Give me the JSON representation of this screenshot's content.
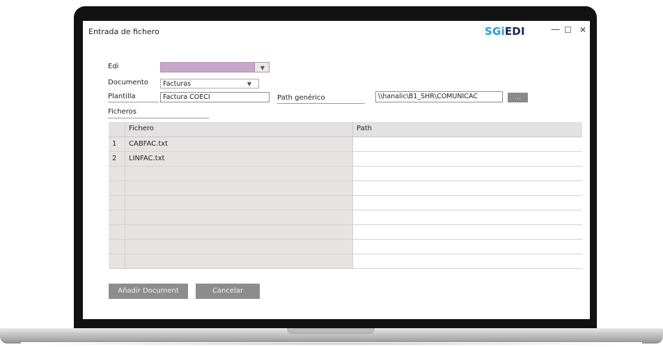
{
  "window": {
    "title": "Entrada de fichero",
    "logo_sg": "SG",
    "logo_i": "i",
    "logo_edi": "EDI",
    "minimize_label": "—",
    "maximize_label": "☐",
    "close_label": "✕"
  },
  "form": {
    "edi_label": "Edi",
    "edi_value": "",
    "edi_color": "#c7a6c9",
    "documento_label": "Documento",
    "documento_value": "Facturas",
    "plantilla_label": "Plantilla",
    "plantilla_value": "Factura COECI",
    "path_generico_label": "Path genérico",
    "path_generico_value": "\\\\hanalic\\B1_SHR\\COMUNICAC",
    "browse_label": "...",
    "ficheros_label": "Ficheros",
    "dropdown_arrow": "▼"
  },
  "table": {
    "columns": [
      "",
      "Fichero",
      "Path"
    ],
    "rows": [
      {
        "num": "1",
        "fichero": "CABFAC.txt",
        "path": ""
      },
      {
        "num": "2",
        "fichero": "LINFAC.txt",
        "path": ""
      },
      {
        "num": "",
        "fichero": "",
        "path": ""
      },
      {
        "num": "",
        "fichero": "",
        "path": ""
      },
      {
        "num": "",
        "fichero": "",
        "path": ""
      },
      {
        "num": "",
        "fichero": "",
        "path": ""
      },
      {
        "num": "",
        "fichero": "",
        "path": ""
      },
      {
        "num": "",
        "fichero": "",
        "path": ""
      },
      {
        "num": "",
        "fichero": "",
        "path": ""
      }
    ]
  },
  "buttons": {
    "add_label": "Añadir Document",
    "cancel_label": "Cancelar"
  }
}
